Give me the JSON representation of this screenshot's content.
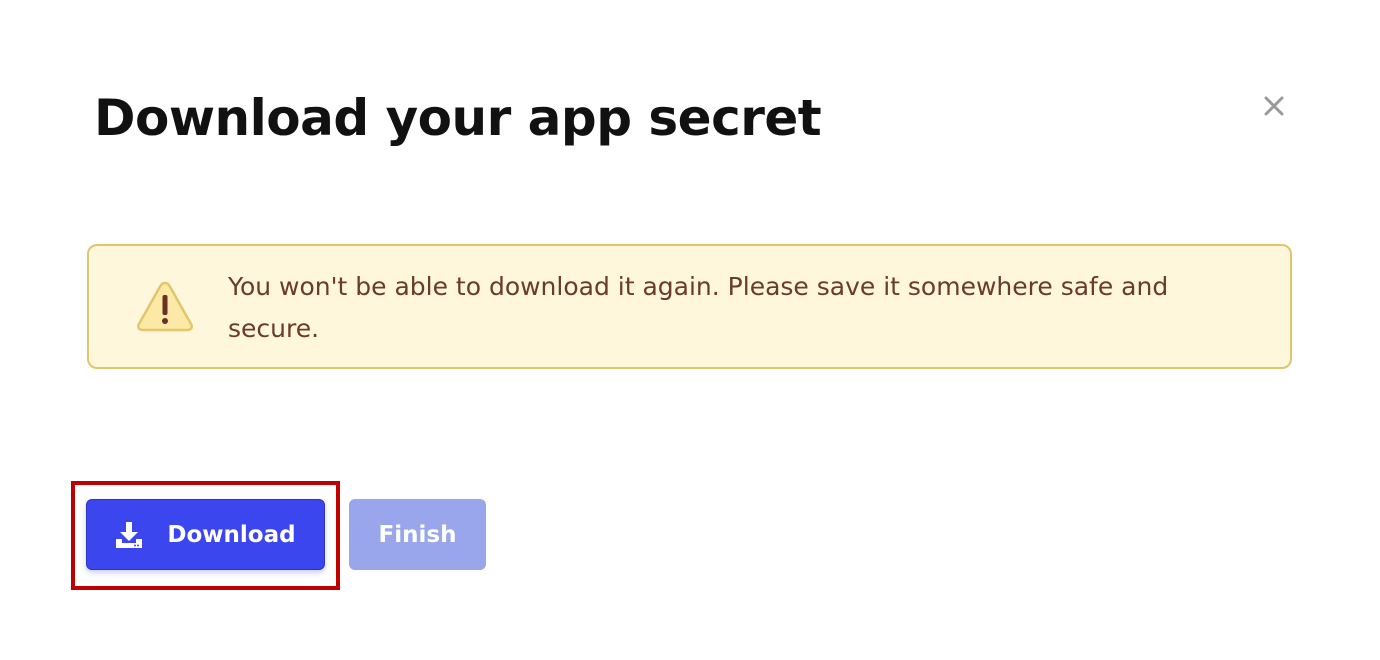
{
  "dialog": {
    "title": "Download your app secret",
    "close_icon": "close-icon"
  },
  "warning": {
    "icon": "warning-triangle-icon",
    "message": "You won't be able to download it again. Please save it somewhere safe and secure.",
    "colors": {
      "background": "#fef7dc",
      "border": "#dfc56b",
      "text": "#6b3a2a"
    }
  },
  "actions": {
    "download": {
      "label": "Download",
      "icon": "download-icon",
      "color": "#3c46ef"
    },
    "finish": {
      "label": "Finish",
      "color": "#9aa6ec"
    }
  },
  "annotation": {
    "highlight_color": "#c00000"
  }
}
